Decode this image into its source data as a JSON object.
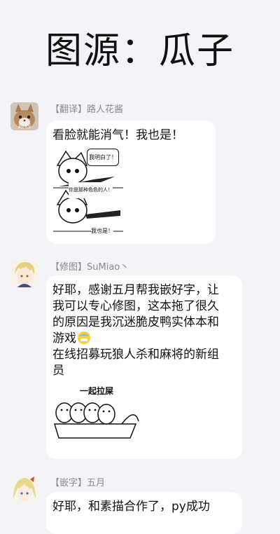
{
  "header": {
    "title": "图源：瓜子"
  },
  "messages": [
    {
      "sender": "【翻译】路人花酱",
      "avatar_icon": "cat-avatar-icon",
      "avatar_text": "超凶",
      "lines": [
        "看脸就能消气！我也是！"
      ],
      "sticker": {
        "bubble_top": "我明白了！",
        "bubble_mid": "你是那种色色的人！",
        "bubble_bottom": "我也是！"
      }
    },
    {
      "sender": "【修图】SuMiao丶",
      "avatar_icon": "anime-boy-avatar-icon",
      "lines": [
        "好耶，感谢五月帮我嵌好字，让",
        "我可以专心修图，这本拖了很久",
        "的原因是我沉迷脆皮鸭实体本和",
        "游戏",
        "在线招募玩狼人杀和麻将的新组",
        "员"
      ],
      "emoji_icon": "cold-sweat-emoji-icon",
      "sticker": {
        "caption": "一起拉屎"
      }
    },
    {
      "sender": "【嵌字】五月",
      "avatar_icon": "anime-girl-avatar-icon",
      "lines": [
        "好耶，和素描合作了，py成功"
      ]
    }
  ]
}
